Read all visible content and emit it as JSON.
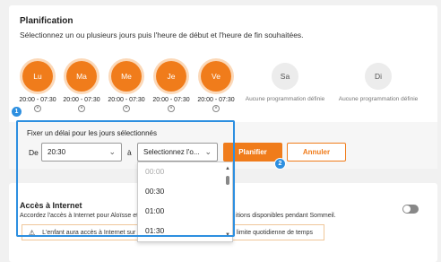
{
  "planning": {
    "title": "Planification",
    "subtitle": "Sélectionnez un ou plusieurs jours puis l'heure de début et l'heure de fin souhaitées."
  },
  "days": [
    {
      "label": "Lu",
      "time": "20:00 - 07:30",
      "active": true
    },
    {
      "label": "Ma",
      "time": "20:00 - 07:30",
      "active": true
    },
    {
      "label": "Me",
      "time": "20:00 - 07:30",
      "active": true
    },
    {
      "label": "Je",
      "time": "20:00 - 07:30",
      "active": true
    },
    {
      "label": "Ve",
      "time": "20:00 - 07:30",
      "active": true
    },
    {
      "label": "Sa",
      "time": "Aucune programmation définie",
      "active": false
    },
    {
      "label": "Di",
      "time": "Aucune programmation définie",
      "active": false
    }
  ],
  "delay": {
    "label": "Fixer un délai pour les jours sélectionnés",
    "from_label": "De",
    "from_value": "20:30",
    "to_label": "à",
    "to_value": "Selectionnez l'o...",
    "schedule_button": "Planifier",
    "cancel_button": "Annuler"
  },
  "dropdown": {
    "options": [
      "00:00",
      "00:30",
      "01:00",
      "01:30"
    ]
  },
  "badges": {
    "first": "1",
    "second": "2"
  },
  "internet": {
    "title": "Accès à Internet",
    "desc_left": "Accordez l'accès à Internet pour Aloïsse et",
    "desc_right": "itions disponibles pendant Sommeil.",
    "warning_left": "L'enfant aura accès à Internet sur ce",
    "warning_right": "e la limite quotidienne de temps"
  },
  "colors": {
    "accent": "#f07c1b",
    "highlight": "#2d8fe0"
  }
}
